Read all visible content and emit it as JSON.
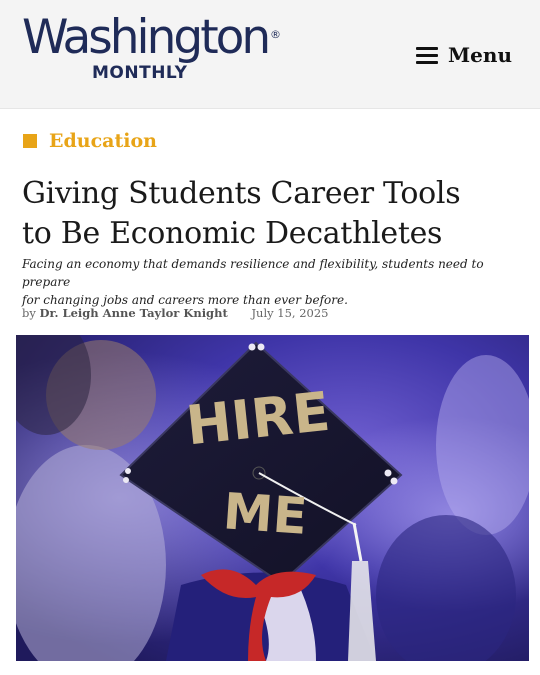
{
  "header": {
    "logo_main": "Washington",
    "logo_sub": "MONTHLY",
    "logo_reg": "®",
    "menu_label": "Menu"
  },
  "article": {
    "category": "Education",
    "title_line1": "Giving Students Career Tools",
    "title_line2": "to Be Economic Decathletes",
    "dek_line1": "Facing an economy that demands resilience and flexibility, students need to prepare",
    "dek_line2": "for changing jobs and careers more than ever before.",
    "byline_prefix": "by",
    "author": "Dr. Leigh Anne Taylor Knight",
    "date": "July 15, 2025"
  },
  "hero_image": {
    "cap_line1": "HIRE",
    "cap_line2": "ME"
  },
  "colors": {
    "brand_navy": "#1f2b58",
    "category_gold": "#e8a417"
  }
}
